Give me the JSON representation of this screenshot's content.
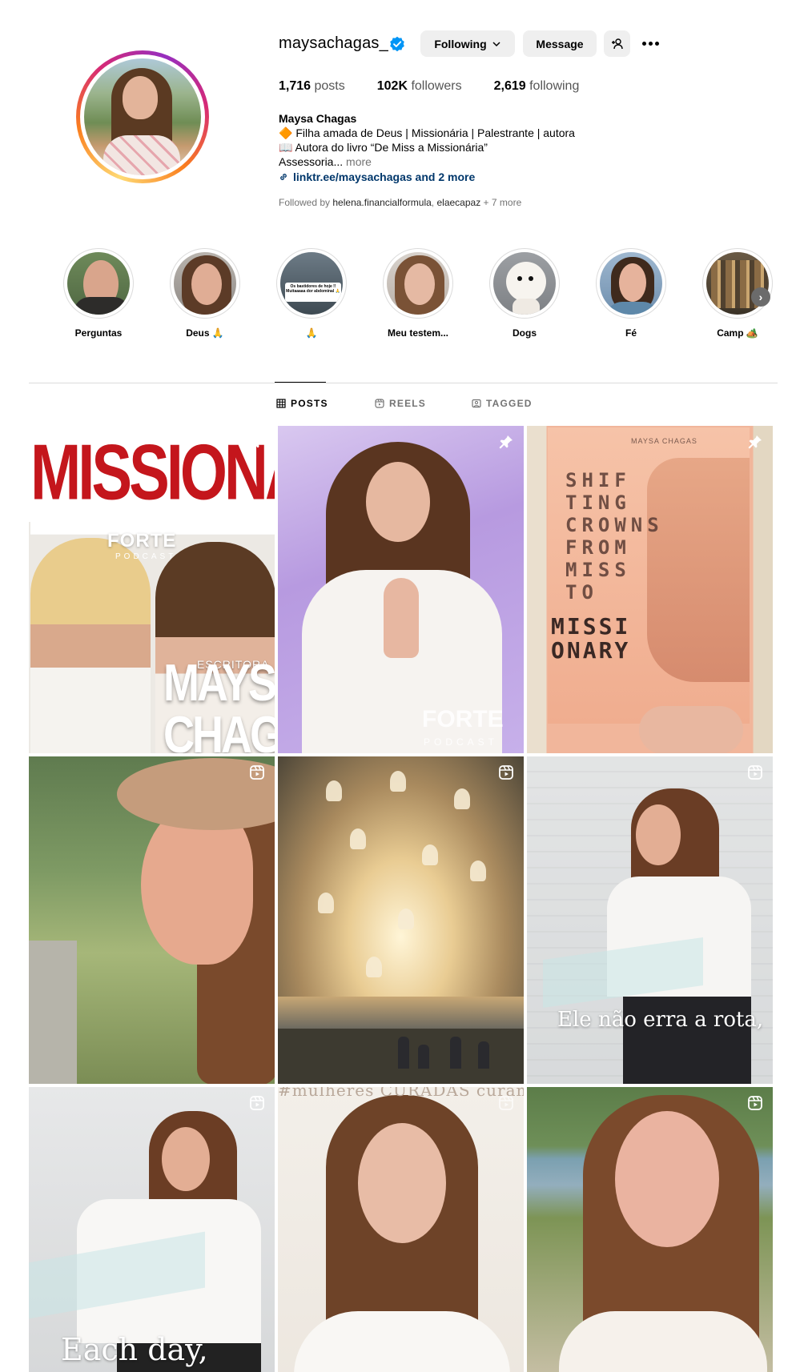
{
  "profile": {
    "username": "maysachagas_",
    "verified": true,
    "buttons": {
      "following": "Following",
      "message": "Message"
    },
    "stats": [
      {
        "value": "1,716",
        "label": "posts"
      },
      {
        "value": "102K",
        "label": "followers"
      },
      {
        "value": "2,619",
        "label": "following"
      }
    ],
    "bio": {
      "name": "Maysa Chagas",
      "line1": "🔶 Filha amada de Deus | Missionária | Palestrante | autora",
      "line2": "📖 Autora do livro “De Miss a Missionária”",
      "line3": "Assessoria...",
      "more": "more",
      "link": "linktr.ee/maysachagas and 2 more"
    },
    "followed_by": {
      "prefix": "Followed by",
      "user1": "helena.financialformula",
      "sep": ",",
      "user2": "elaecapaz",
      "suffix": "+ 7 more"
    }
  },
  "highlights": [
    {
      "label": "Perguntas"
    },
    {
      "label": "Deus 🙏"
    },
    {
      "label": "🙏",
      "inner_text": "Os bastidores de hoje !! Muitaaaaa dor abdominal 🙏"
    },
    {
      "label": "Meu testem..."
    },
    {
      "label": "Dogs"
    },
    {
      "label": "Fé"
    },
    {
      "label": "Camp 🏕️"
    }
  ],
  "tabs": [
    {
      "label": "POSTS",
      "active": true
    },
    {
      "label": "REELS",
      "active": false
    },
    {
      "label": "TAGGED",
      "active": false
    }
  ],
  "posts": [
    {
      "type": "pinned",
      "texts": {
        "title": "MISSIONARIA",
        "forte": "FORTE",
        "podcast": "PODCAST",
        "escritora": "ESCRITORA",
        "maysa": "MAYSA",
        "chagas": "CHAGAS"
      }
    },
    {
      "type": "pinned",
      "texts": {
        "forte": "FORTE",
        "podcast": "PODCAST"
      }
    },
    {
      "type": "pinned",
      "texts": {
        "book_brand": "MAYSA CHAGAS",
        "line1": "SHIF",
        "line2": "TING",
        "line3": "CROWNS",
        "line4": "FROM",
        "line5": "MISS",
        "line6": "TO",
        "missi": "MISSI",
        "onary": "ONARY"
      }
    },
    {
      "type": "reel"
    },
    {
      "type": "reel"
    },
    {
      "type": "reel",
      "texts": {
        "overlay": "Ele não erra a rota,"
      }
    },
    {
      "type": "reel",
      "texts": {
        "overlay": "Each day,"
      }
    },
    {
      "type": "reel",
      "texts": {
        "toptext": "#mulheres CURADAS curam"
      }
    },
    {
      "type": "reel"
    }
  ],
  "icons": {
    "verified": "verified-badge-icon",
    "pinned": "pin-icon",
    "reel": "reels-icon"
  },
  "colors": {
    "verified_blue": "#0095f6",
    "link_blue": "#00376b",
    "button_gray": "#efefef"
  }
}
